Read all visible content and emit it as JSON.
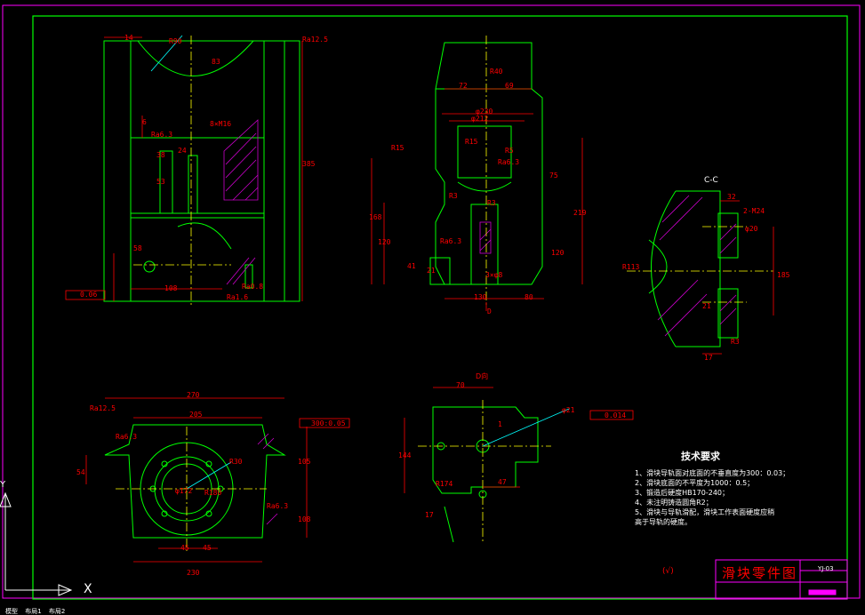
{
  "drawing": {
    "technical_requirements": {
      "title": "技术要求",
      "lines": [
        "1、滑块导轨面对底面的不垂直度为300：0.03；",
        "2、滑块底面的不平度为1000：0.5；",
        "3、锻造后硬度HB170-240；",
        "4、未注明铸造圆角R2；",
        "5、滑块与导轨滑配，滑块工作表面硬度应稍",
        "高于导轨的硬度。"
      ]
    },
    "title_block": {
      "name": "滑块零件图",
      "code": "YJ-03"
    },
    "roughness_note": "(√)",
    "section_label": "C-C",
    "view_label": "D向"
  },
  "dimensions": {
    "front": [
      "14",
      "R90",
      "Ra12.5",
      "83",
      "6",
      "8×M16",
      "Ra6.3",
      "24",
      "38",
      "53",
      "385",
      "58",
      "108",
      "Ra1.6",
      "0.06",
      "Ra0.8"
    ],
    "side": [
      "72",
      "69",
      "R40",
      "φ230",
      "φ212",
      "R15",
      "R15",
      "Ra6.3",
      "R3",
      "168",
      "120",
      "Ra6.3",
      "R5",
      "75",
      "219",
      "R3",
      "130",
      "80",
      "3×φ8",
      "21",
      "41",
      "120",
      "D"
    ],
    "section": [
      "32",
      "2-M24",
      "φ20",
      "R113",
      "185",
      "R3",
      "17",
      "21"
    ],
    "top": [
      "270",
      "205",
      "Ra12.5",
      "Ra6.3",
      "300:0.05",
      "105",
      "54",
      "φ172",
      "R180",
      "R30",
      "Ra6.3",
      "45",
      "45",
      "230",
      "108"
    ],
    "dview": [
      "70",
      "1",
      "φ21",
      "0.014",
      "144",
      "R174",
      "47",
      "17"
    ]
  },
  "ui": {
    "axis_x": "X",
    "axis_y": "Y",
    "model_tabs": [
      "模型",
      "布局1",
      "布局2"
    ]
  },
  "colors": {
    "geometry": "#00ff00",
    "dimension": "#ff0000",
    "hatch": "#cc00cc",
    "center": "#ffff00",
    "leader": "#00ffff",
    "frame": "#00ff00",
    "sheet": "#ff00ff"
  }
}
